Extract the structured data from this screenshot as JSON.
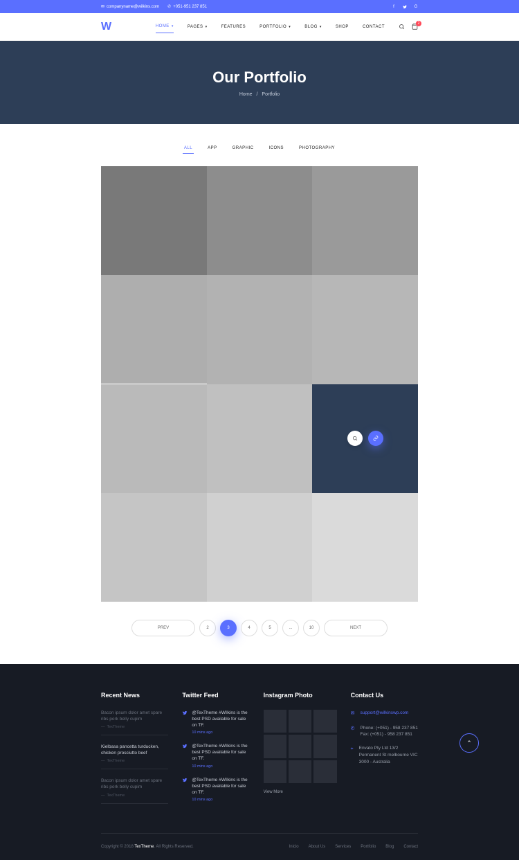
{
  "topbar": {
    "email": "companyname@wilkins.com",
    "phone": "+051-951 237 851"
  },
  "logo": "W",
  "nav": {
    "items": [
      {
        "label": "HOME",
        "active": true,
        "dd": true
      },
      {
        "label": "PAGES",
        "dd": true
      },
      {
        "label": "FEATURES"
      },
      {
        "label": "PORTFOLIO",
        "dd": true
      },
      {
        "label": "BLOG",
        "dd": true
      },
      {
        "label": "SHOP"
      },
      {
        "label": "CONTACT"
      }
    ],
    "cart_badge": "2"
  },
  "hero": {
    "title": "Our Portfolio",
    "crumb_home": "Home",
    "crumb_sep": "/",
    "crumb_current": "Portfolio"
  },
  "filters": [
    {
      "label": "ALL",
      "active": true
    },
    {
      "label": "APP"
    },
    {
      "label": "GRAPHIC"
    },
    {
      "label": "ICONS"
    },
    {
      "label": "PHOTOGRAPHY"
    }
  ],
  "pagination": {
    "prev": "PREV",
    "next": "NEXT",
    "pages": [
      "2",
      "3",
      "4",
      "5",
      "...",
      "10"
    ],
    "active_index": 1
  },
  "footer": {
    "cols": {
      "news": {
        "title": "Recent News",
        "items": [
          {
            "title": "Bacon ipsum dolor amet spare ribs pork belly cupim",
            "author": "TexTheme",
            "dim": true
          },
          {
            "title": "Kielbasa pancetta turducken, chicken prosciutto beef",
            "author": "TexTheme",
            "dim": false
          },
          {
            "title": "Bacon ipsum dolor amet spare ribs pork belly cupim",
            "author": "TexTheme",
            "dim": true
          }
        ]
      },
      "twitter": {
        "title": "Twitter Feed",
        "items": [
          {
            "text": "@TexTheme  #Wilkins is the best PSD available for sale on TF.",
            "time": "10 mins ago"
          },
          {
            "text": "@TexTheme  #Wilkins is the best PSD available for sale on TF.",
            "time": "10 mins ago"
          },
          {
            "text": "@TexTheme  #Wilkins is the best PSD available for sale on TF.",
            "time": "10 mins ago"
          }
        ]
      },
      "instagram": {
        "title": "Instagram Photo",
        "viewmore": "View More"
      },
      "contact": {
        "title": "Contact Us",
        "email": "support@wilkinswp.com",
        "phone": "Phone: (+051) - 958 237 851\nFax: (+051) - 958 237 851",
        "address": "Envato Pty Ltd 13/2 Permanent St melbourne VIC 3000 - Australia"
      }
    },
    "copyright_pre": "Copyright © 2018 ",
    "copyright_brand": "TexTheme",
    "copyright_post": ". All Rights Reserved.",
    "nav": [
      "Inicio",
      "About Us",
      "Services",
      "Portfolio",
      "Blog",
      "Contact"
    ]
  }
}
